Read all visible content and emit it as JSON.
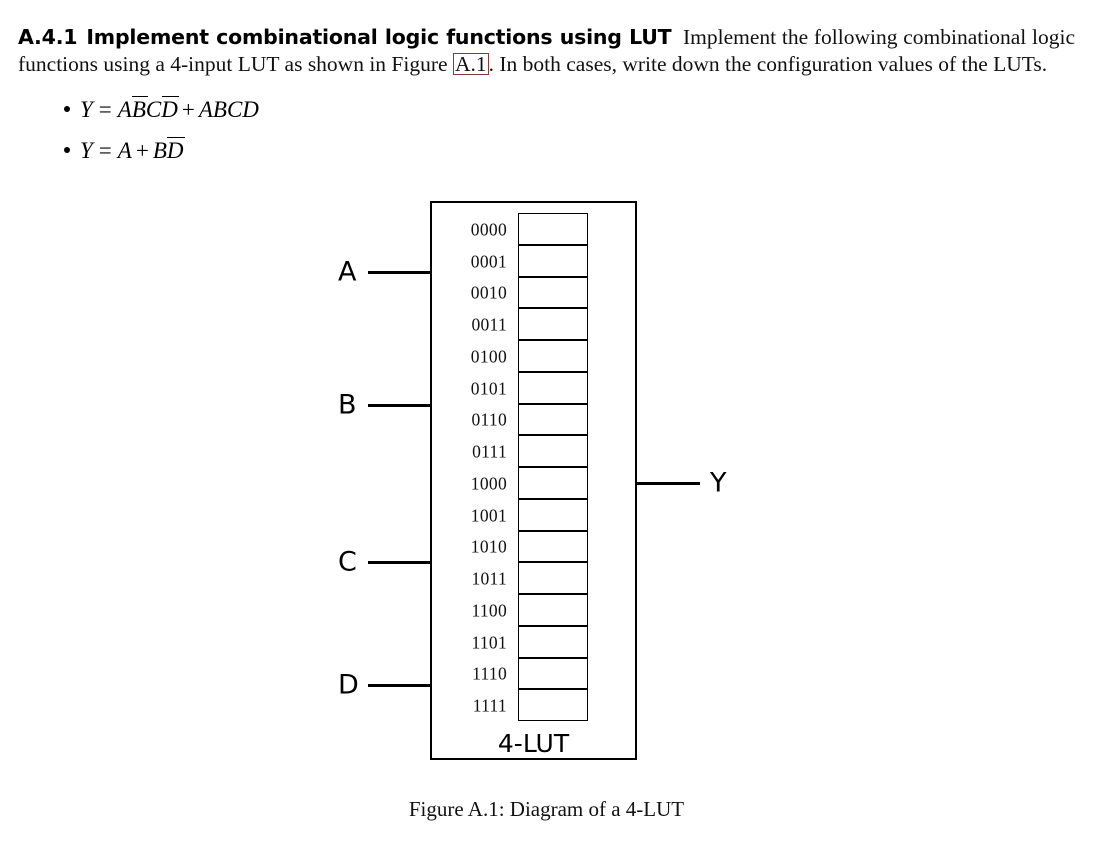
{
  "exercise": {
    "number": "A.4.1",
    "title": "Implement combinational logic functions using LUT",
    "body_before_ref": "Implement the following combinational logic functions using a 4-input LUT as shown in Figure",
    "reference_link": "A.1",
    "body_after_ref": ". In both cases, write down the configuration values of the LUTs.",
    "equations": [
      {
        "lhs": "Y",
        "eq": "=",
        "terms": [
          "A",
          "B̅",
          "C",
          "D̅",
          "+",
          "ABCD"
        ],
        "plain": "Y = A B̅ C D̅ + ABCD"
      },
      {
        "lhs": "Y",
        "eq": "=",
        "terms": [
          "A",
          "+",
          "B",
          "D̅"
        ],
        "plain": "Y = A + B D̅"
      }
    ]
  },
  "figure": {
    "caption": "Figure A.1: Diagram of a 4-LUT",
    "block_label": "4-LUT",
    "inputs": [
      {
        "label": "A"
      },
      {
        "label": "B"
      },
      {
        "label": "C"
      },
      {
        "label": "D"
      }
    ],
    "output": {
      "label": "Y"
    },
    "lut_rows": [
      {
        "address": "0000",
        "value": ""
      },
      {
        "address": "0001",
        "value": ""
      },
      {
        "address": "0010",
        "value": ""
      },
      {
        "address": "0011",
        "value": ""
      },
      {
        "address": "0100",
        "value": ""
      },
      {
        "address": "0101",
        "value": ""
      },
      {
        "address": "0110",
        "value": ""
      },
      {
        "address": "0111",
        "value": ""
      },
      {
        "address": "1000",
        "value": ""
      },
      {
        "address": "1001",
        "value": ""
      },
      {
        "address": "1010",
        "value": ""
      },
      {
        "address": "1011",
        "value": ""
      },
      {
        "address": "1100",
        "value": ""
      },
      {
        "address": "1101",
        "value": ""
      },
      {
        "address": "1110",
        "value": ""
      },
      {
        "address": "1111",
        "value": ""
      }
    ]
  },
  "colors": {
    "link_border": "#8b3a3a",
    "ink": "#000000",
    "page_background": "#ffffff"
  }
}
